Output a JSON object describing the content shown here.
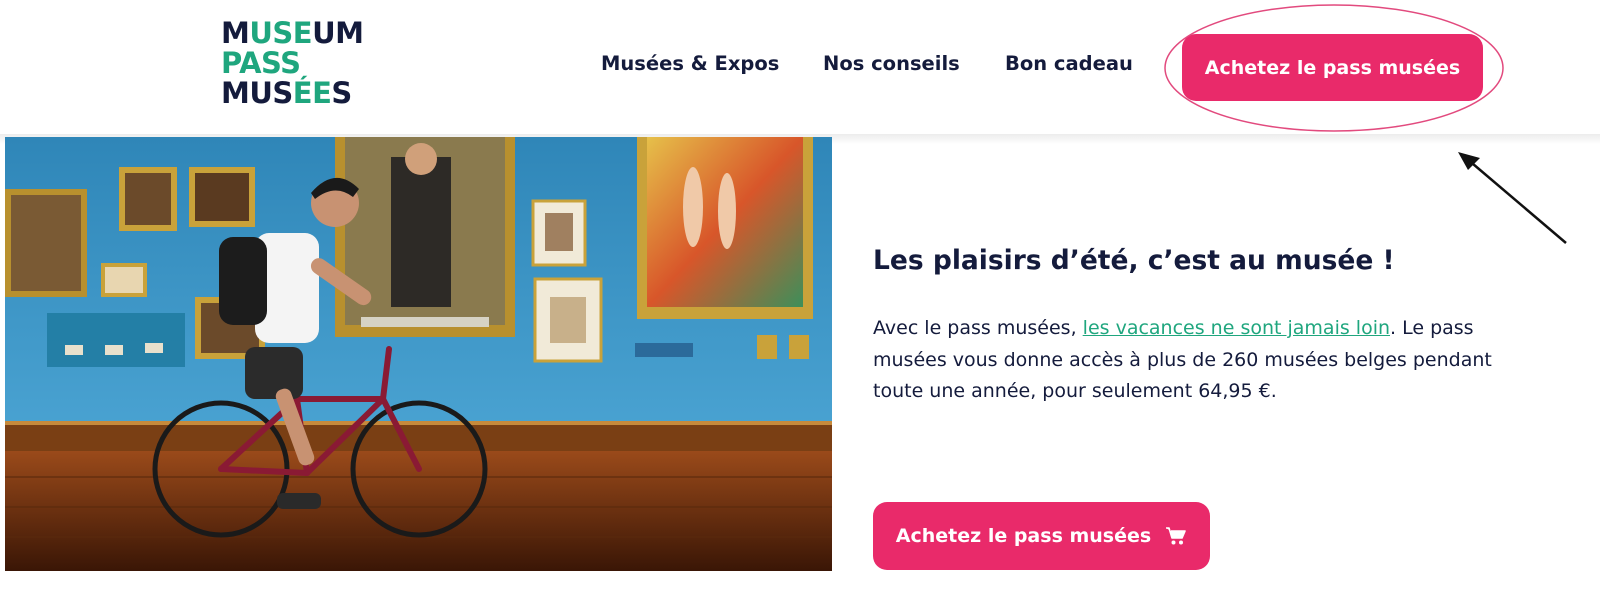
{
  "brand": {
    "logo_lines": [
      [
        {
          "text": "M",
          "accent": false
        },
        {
          "text": "USE",
          "accent": true
        },
        {
          "text": "UM",
          "accent": false
        }
      ],
      [
        {
          "text": "PASS",
          "accent": true
        }
      ],
      [
        {
          "text": "MUS",
          "accent": false
        },
        {
          "text": "ÉE",
          "accent": true
        },
        {
          "text": "S",
          "accent": false
        }
      ]
    ]
  },
  "nav": {
    "museums_label": "Musées & Expos",
    "tips_label": "Nos conseils",
    "gift_label": "Bon cadeau",
    "cta_label": "Achetez le pass musées"
  },
  "hero": {
    "headline": "Les plaisirs d’été, c’est au musée !",
    "body_before": "Avec le pass musées, ",
    "body_link": "les vacances ne sont jamais loin",
    "body_after": ". Le pass musées vous donne accès à plus de 260 musées belges pendant toute une année, pour seulement 64,95 €.",
    "cta_label": "Achetez le pass musées",
    "cta_icon": "shopping-cart-icon"
  },
  "colors": {
    "brand_navy": "#141b3c",
    "brand_green": "#1fa67e",
    "cta_pink": "#e92a6a",
    "gallery_wall": "#3a8fbf"
  }
}
